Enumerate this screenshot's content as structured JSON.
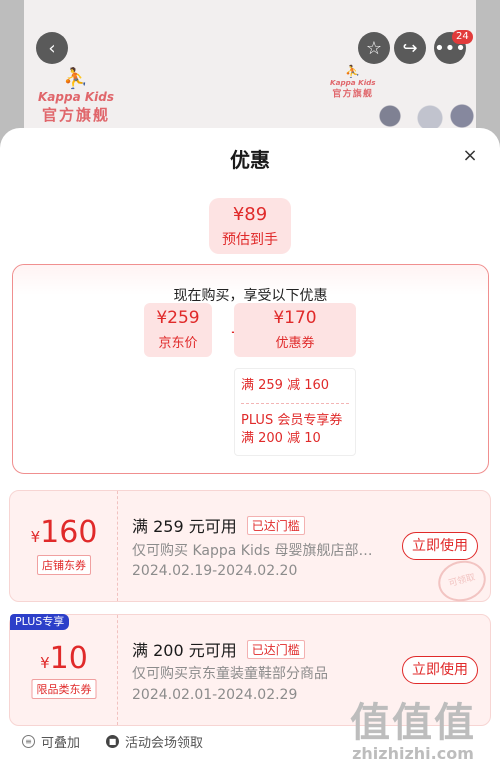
{
  "background": {
    "badge_count": "24",
    "logo_left": {
      "brand": "Kappa Kids",
      "cn": "官方旗舰"
    },
    "logo_right": {
      "brand": "Kappa Kids",
      "cn": "官方旗舰"
    }
  },
  "sheet": {
    "title": "优惠",
    "close": "×",
    "estimate": {
      "price": "¥89",
      "label": "预估到手"
    },
    "calc": {
      "title": "现在购买，享受以下优惠",
      "jd_price": {
        "value": "¥259",
        "label": "京东价"
      },
      "minus": "-",
      "coupon_total": {
        "value": "¥170",
        "label": "优惠券"
      },
      "details": [
        "满 259 减 160",
        "PLUS 会员专享券",
        "满 200 减 10"
      ]
    },
    "coupons": [
      {
        "yen": "¥",
        "amount": "160",
        "type": "店铺东券",
        "condition": "满 259 元可用",
        "tag": "已达门槛",
        "desc": "仅可购买 Kappa Kids 母婴旗舰店部分商品",
        "date": "2024.02.19-2024.02.20",
        "button": "立即使用",
        "stamp": "可领取"
      },
      {
        "plus_tag": "PLUS专享",
        "yen": "¥",
        "amount": "10",
        "type": "限品类东券",
        "condition": "满 200 元可用",
        "tag": "已达门槛",
        "desc": "仅可购买京东童装童鞋部分商品",
        "date": "2024.02.01-2024.02.29",
        "button": "立即使用"
      }
    ],
    "footer": [
      "可叠加",
      "活动会场领取"
    ]
  },
  "watermark": {
    "big": "值值值",
    "site": "zhizhizhi.com"
  },
  "colors": {
    "accent": "#e02a2a",
    "pink_bg": "#fde3e3",
    "plus_blue": "#2c3fc9"
  }
}
